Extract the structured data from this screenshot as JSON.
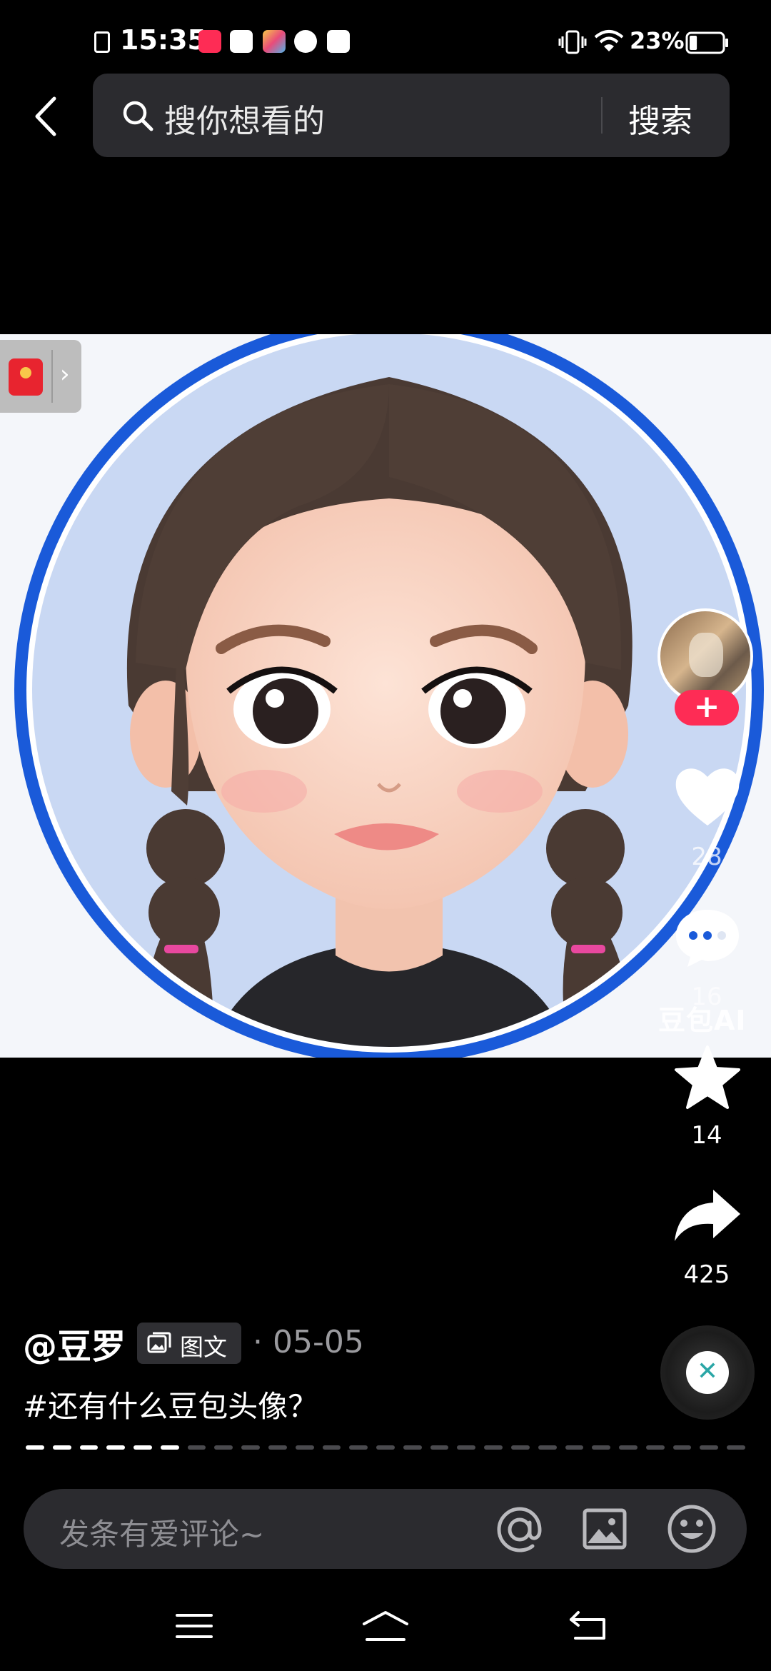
{
  "status_bar": {
    "time": "15:35",
    "battery_percent": "23%",
    "battery_level": 0.23
  },
  "search": {
    "placeholder": "搜你想看的",
    "button_label": "搜索"
  },
  "media": {
    "watermark": "豆包AI"
  },
  "actions": {
    "like_count": "28",
    "comment_count": "16",
    "favorite_count": "14",
    "share_count": "425"
  },
  "post": {
    "author": "@豆罗",
    "type_badge": "图文",
    "date": "· 05-05",
    "caption": "#还有什么豆包头像？"
  },
  "progress": {
    "total_segments": 27,
    "viewed_segments": 6
  },
  "comment": {
    "placeholder": "发条有爱评论~"
  },
  "colors": {
    "accent_red": "#fe2c55",
    "avatar_ring_blue": "#1a5ad9",
    "background": "#000000"
  }
}
